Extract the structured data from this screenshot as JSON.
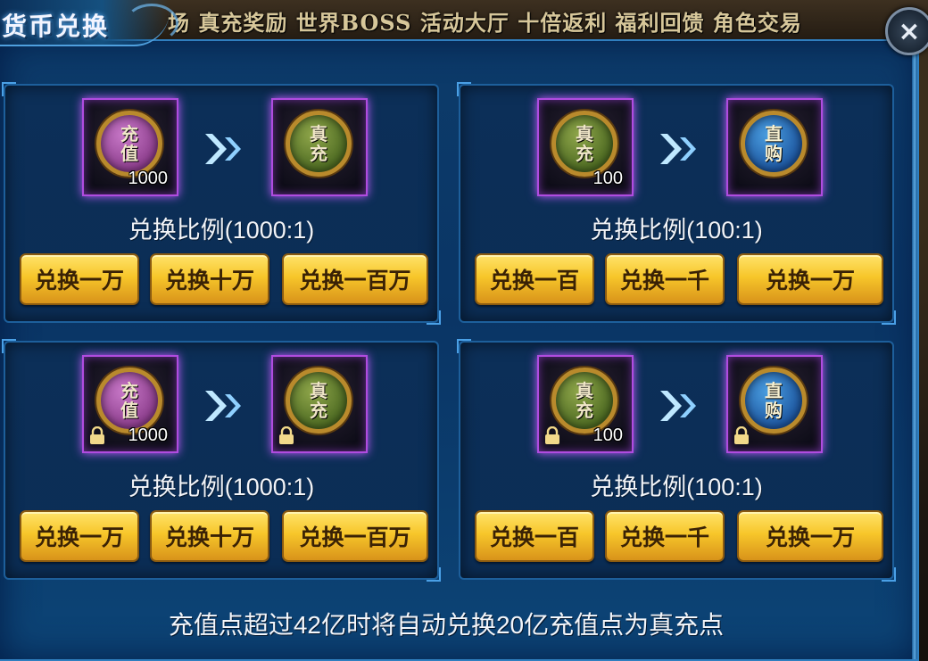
{
  "window": {
    "title": "货币兑换",
    "close_symbol": "×"
  },
  "marquee": "场 真充奖励 世界BOSS 活动大厅 十倍返利 福利回馈 角色交易",
  "cards": [
    {
      "from": {
        "label": "充值",
        "qty": "1000",
        "color": "purple",
        "locked": false
      },
      "to": {
        "label": "真充",
        "color": "green",
        "locked": false
      },
      "ratio": "兑换比例(1000:1)",
      "buttons": [
        "兑换一万",
        "兑换十万",
        "兑换一百万"
      ]
    },
    {
      "from": {
        "label": "真充",
        "qty": "100",
        "color": "green",
        "locked": false
      },
      "to": {
        "label": "直购",
        "color": "blue",
        "locked": false
      },
      "ratio": "兑换比例(100:1)",
      "buttons": [
        "兑换一百",
        "兑换一千",
        "兑换一万"
      ]
    },
    {
      "from": {
        "label": "充值",
        "qty": "1000",
        "color": "purple",
        "locked": true
      },
      "to": {
        "label": "真充",
        "color": "green",
        "locked": true
      },
      "ratio": "兑换比例(1000:1)",
      "buttons": [
        "兑换一万",
        "兑换十万",
        "兑换一百万"
      ]
    },
    {
      "from": {
        "label": "真充",
        "qty": "100",
        "color": "green",
        "locked": true
      },
      "to": {
        "label": "直购",
        "color": "blue",
        "locked": true
      },
      "ratio": "兑换比例(100:1)",
      "buttons": [
        "兑换一百",
        "兑换一千",
        "兑换一万"
      ]
    }
  ],
  "notice": "充值点超过42亿时将自动兑换20亿充值点为真充点",
  "colors": {
    "panel_blue": "#0c3b6a",
    "button_gold": "#f7c62a",
    "slot_glow": "#c35cff"
  }
}
